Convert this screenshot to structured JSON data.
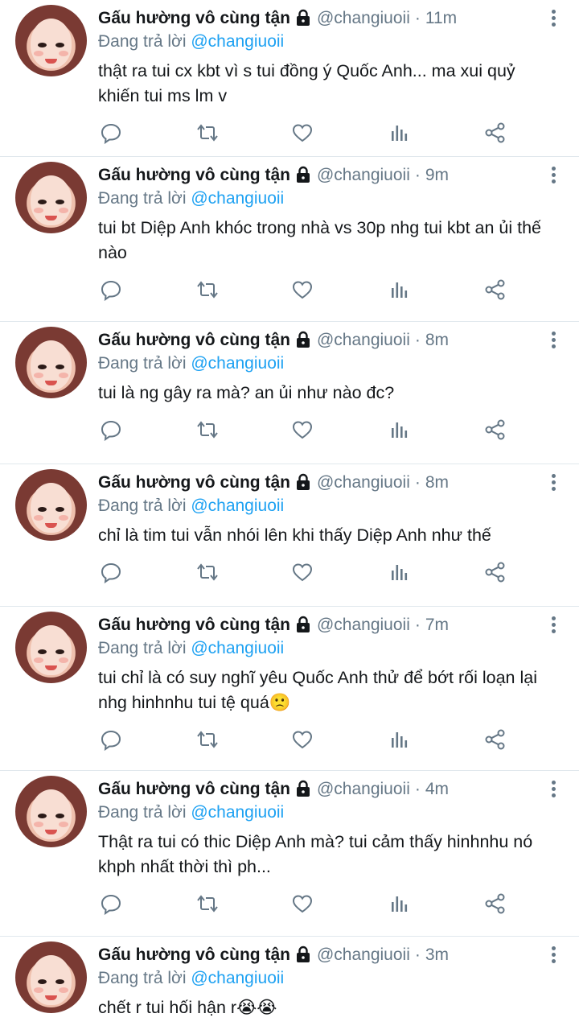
{
  "colors": {
    "accent": "#1da1f2",
    "muted": "#657786",
    "text": "#14171a",
    "divider": "#e1e8ed"
  },
  "tweets": [
    {
      "name": "Gấu hường vô cùng tận",
      "handle": "@changiuoii",
      "time": "11m",
      "reply_prefix": "Đang trả lời",
      "reply_to": "@changiuoii",
      "text": "thật ra tui cx kbt vì s tui đồng ý Quốc Anh... ma xui quỷ khiến tui ms lm v"
    },
    {
      "name": "Gấu hường vô cùng tận",
      "handle": "@changiuoii",
      "time": "9m",
      "reply_prefix": "Đang trả lời",
      "reply_to": "@changiuoii",
      "text": "tui bt Diệp Anh khóc trong nhà vs 30p nhg tui kbt an ủi thế nào"
    },
    {
      "name": "Gấu hường vô cùng tận",
      "handle": "@changiuoii",
      "time": "8m",
      "reply_prefix": "Đang trả lời",
      "reply_to": "@changiuoii",
      "text": "tui là ng gây ra mà? an ủi như nào đc?"
    },
    {
      "name": "Gấu hường vô cùng tận",
      "handle": "@changiuoii",
      "time": "8m",
      "reply_prefix": "Đang trả lời",
      "reply_to": "@changiuoii",
      "text": "chỉ là tim tui vẫn nhói lên khi thấy Diệp Anh như thế"
    },
    {
      "name": "Gấu hường vô cùng tận",
      "handle": "@changiuoii",
      "time": "7m",
      "reply_prefix": "Đang trả lời",
      "reply_to": "@changiuoii",
      "text": "tui chỉ là có suy nghĩ yêu Quốc Anh thử để bớt rối loạn lại nhg hinhnhu tui tệ quá🙁"
    },
    {
      "name": "Gấu hường vô cùng tận",
      "handle": "@changiuoii",
      "time": "4m",
      "reply_prefix": "Đang trả lời",
      "reply_to": "@changiuoii",
      "text": "Thật ra tui có thic Diệp Anh mà? tui cảm thấy hinhnhu nó khph nhất thời thì ph..."
    },
    {
      "name": "Gấu hường vô cùng tận",
      "handle": "@changiuoii",
      "time": "3m",
      "reply_prefix": "Đang trả lời",
      "reply_to": "@changiuoii",
      "text": "chết r tui hối hận r😭😭"
    }
  ]
}
